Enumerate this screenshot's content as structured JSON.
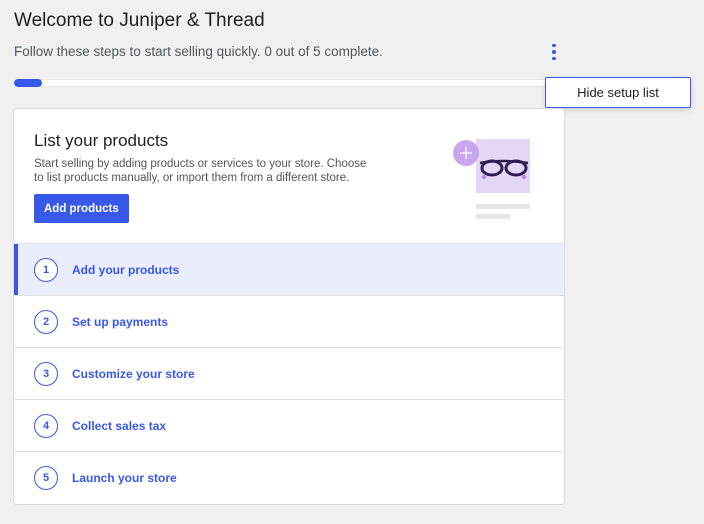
{
  "header": {
    "title": "Welcome to Juniper & Thread",
    "subtitle": "Follow these steps to start selling quickly. 0 out of 5 complete.",
    "progress_fraction": 0.05,
    "menu_icon": "kebab-vertical-icon"
  },
  "popover": {
    "hide_label": "Hide setup list"
  },
  "hero": {
    "title": "List your products",
    "description": "Start selling by adding products or services to your store. Choose to list products manually, or import them from a different store.",
    "button_label": "Add products"
  },
  "steps": [
    {
      "number": "1",
      "label": "Add your products"
    },
    {
      "number": "2",
      "label": "Set up payments"
    },
    {
      "number": "3",
      "label": "Customize your store"
    },
    {
      "number": "4",
      "label": "Collect sales tax"
    },
    {
      "number": "5",
      "label": "Launch your store"
    }
  ],
  "colors": {
    "accent": "#3858e9",
    "active_bg": "#e9edfc",
    "illustration": "#e3d6f7"
  }
}
